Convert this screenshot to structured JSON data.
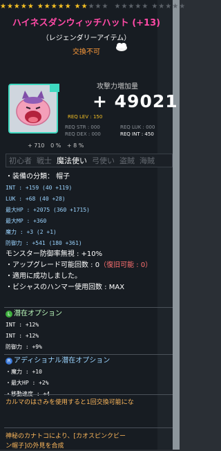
{
  "stars": {
    "row1_filled": 12,
    "row1_total": 15,
    "row2_filled": 0,
    "row2_total": 10
  },
  "title": "ハイネスダンウィッチハット (+13)",
  "rarity": "（レジェンダリーアイテム）",
  "trade_status": "交換不可",
  "attack_increase_label": "攻撃力増加量",
  "attack_increase_value": "+ 49021",
  "requirements": {
    "level": "REQ LEV : 150",
    "str": "REQ STR : 000",
    "luk": "REQ LUK : 000",
    "dex": "REQ DEX : 000",
    "int": "REQ INT : 450"
  },
  "small_stats": [
    "+ 710",
    "0 %",
    "+ 8 %"
  ],
  "jobs": [
    "初心者",
    "戦士",
    "魔法使い",
    "弓使い",
    "盗賊",
    "海賊"
  ],
  "active_job": "魔法使い",
  "properties": {
    "category": "・装備の分類： 帽子",
    "int": {
      "label": "INT",
      "value": ": +159",
      "breakdown": "(40 +119)"
    },
    "luk": {
      "label": "LUK",
      "value": ": +68",
      "breakdown": "(40 +28)"
    },
    "maxhp": {
      "label": "最大HP",
      "value": ": +2075",
      "breakdown": "(360 +1715)"
    },
    "maxmp": {
      "label": "最大MP",
      "value": ": +360"
    },
    "magic": {
      "label": "魔力",
      "value": ": +3",
      "breakdown": "(2 +1)"
    },
    "defense": {
      "label": "防御力",
      "value": ": +541",
      "breakdown": "(180 +361)"
    },
    "monster_def_ignore": "モンスター防御率無視 : +10%",
    "upgrade_label": "・アップグレード可能回数 : 0",
    "upgrade_restore": "（復旧可能 : 0）",
    "applied_success": "・適用に成功しました。",
    "hammer": "・ビシャスのハンマー使用回数 : MAX"
  },
  "potential": {
    "header": "潜在オプション",
    "badge": "L",
    "lines": [
      "INT : +12%",
      "INT : +12%",
      "防御力 : +9%"
    ]
  },
  "additional_potential": {
    "header": "アディショナル潜在オプション",
    "badge": "R",
    "lines": [
      "・魔力 : +10",
      "・最大HP : +2%",
      "・移動速度 : +4"
    ]
  },
  "karma_note": "カルマのはさみを使用すると1回交換可能にな",
  "mystic_note": [
    "神秘のカナトコにより、[カオスピンクビー",
    "ン帽子]の外見を合成"
  ],
  "colors": {
    "title": "#ff4aa6",
    "orange": "#ffb95c",
    "blue": "#9bd4ff",
    "pink_red": "#ff7070",
    "teal_border": "#3fd9c0",
    "gold_star": "#f5c024"
  },
  "icons": [
    "pink-bean-hat-icon",
    "cloud-icon",
    "potential-badge-icon",
    "additional-potential-badge-icon"
  ]
}
